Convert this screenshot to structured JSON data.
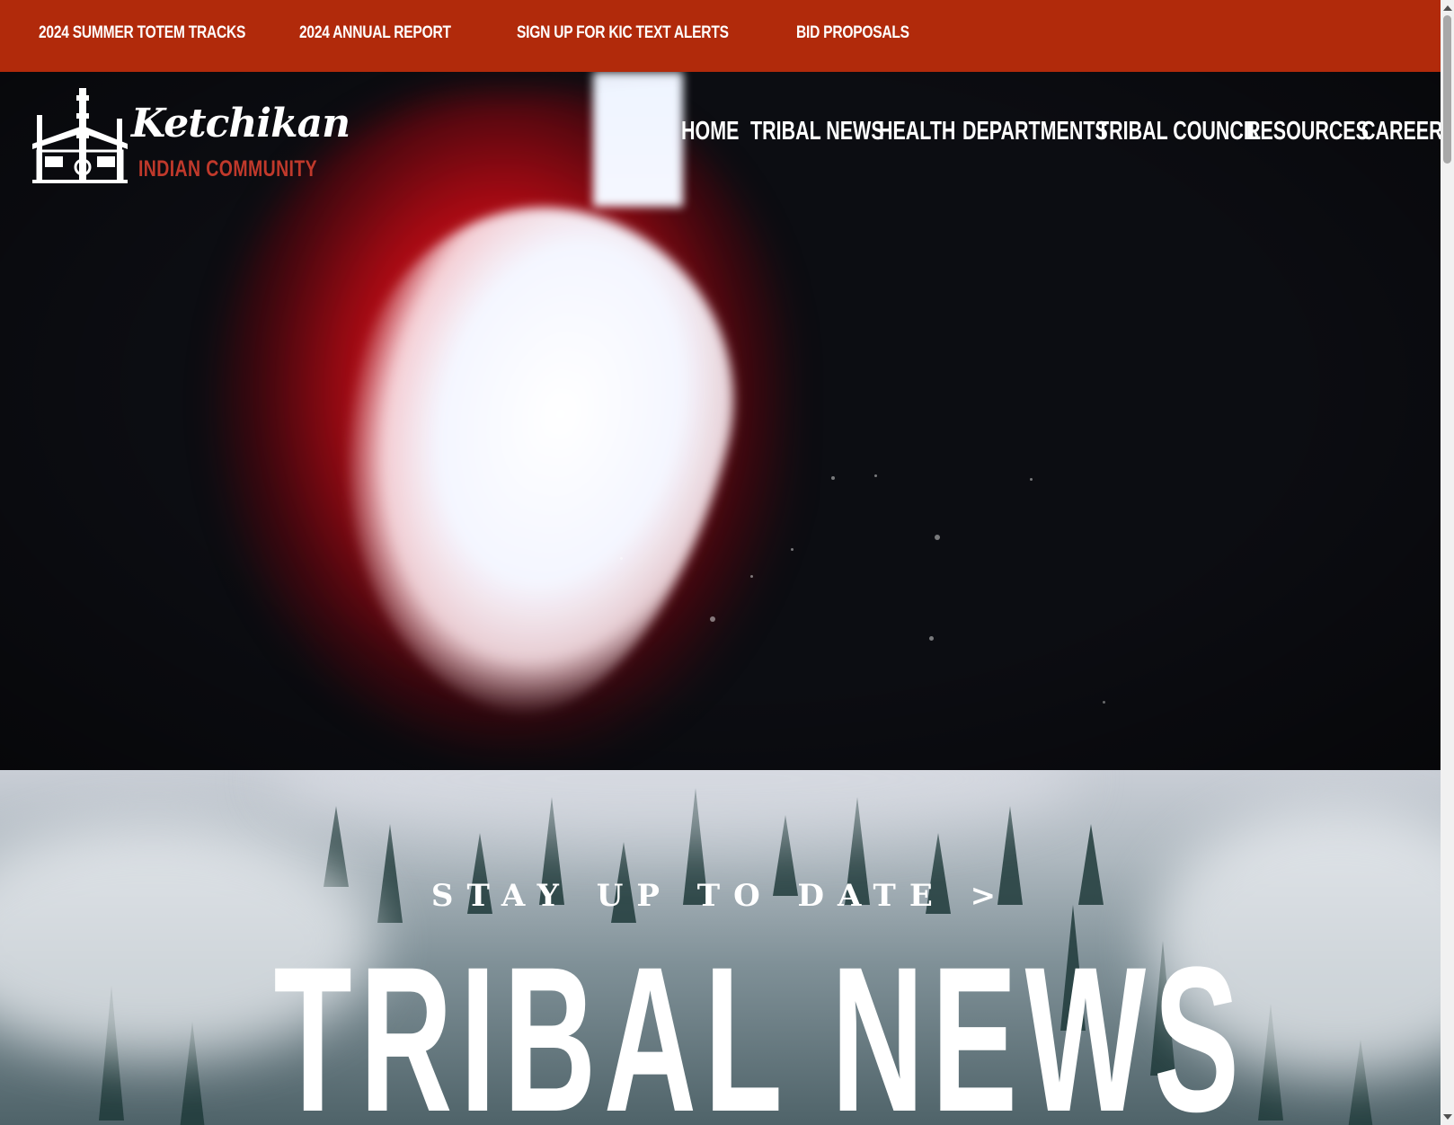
{
  "topbar": {
    "links": [
      {
        "label": "2024 SUMMER TOTEM TRACKS"
      },
      {
        "label": "2024 ANNUAL REPORT"
      },
      {
        "label": "SIGN UP FOR KIC TEXT ALERTS"
      },
      {
        "label": "BID PROPOSALS"
      }
    ]
  },
  "logo": {
    "script": "Ketchikan",
    "subtitle": "INDIAN COMMUNITY"
  },
  "nav": {
    "items": [
      {
        "label": "HOME"
      },
      {
        "label": "TRIBAL NEWS"
      },
      {
        "label": "HEALTH"
      },
      {
        "label": "DEPARTMENTS"
      },
      {
        "label": "TRIBAL COUNCIL"
      },
      {
        "label": "RESOURCES"
      },
      {
        "label": "CAREERS"
      }
    ]
  },
  "news": {
    "tagline": "STAY UP TO DATE >",
    "title": "TRIBAL NEWS"
  },
  "colors": {
    "topbar_bg": "#b12a0b",
    "logo_subtitle": "#c0392b",
    "hero_bg": "#0c0d12"
  }
}
